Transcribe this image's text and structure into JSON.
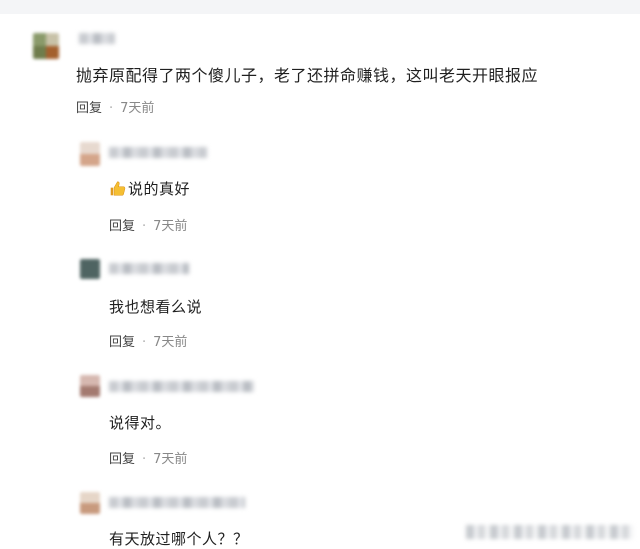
{
  "comments": [
    {
      "text": "抛弃原配得了两个傻儿子，老了还拼命赚钱，这叫老天开眼报应",
      "reply_label": "回复",
      "time": "7天前"
    },
    {
      "emoji": "thumbs-up-icon",
      "text": "说的真好",
      "reply_label": "回复",
      "time": "7天前"
    },
    {
      "text": "我也想看么说",
      "reply_label": "回复",
      "time": "7天前"
    },
    {
      "text": "说得对。",
      "reply_label": "回复",
      "time": "7天前"
    },
    {
      "text": "有天放过哪个人？？"
    }
  ],
  "colors": {
    "background": "#ffffff",
    "text": "#1f1f1f",
    "meta": "#888888",
    "thumb": "#f2b52c"
  }
}
